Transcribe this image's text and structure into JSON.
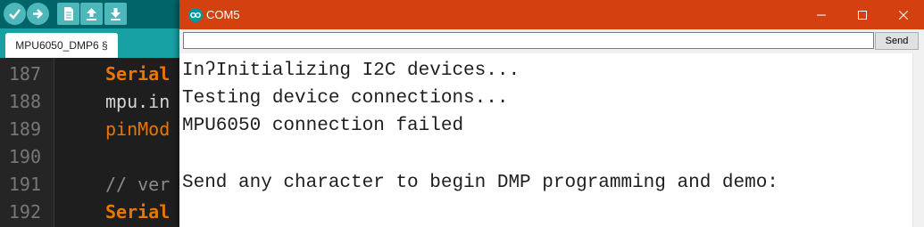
{
  "ide": {
    "toolbar": {
      "buttons": [
        {
          "icon": "verify-icon"
        },
        {
          "icon": "upload-icon"
        },
        {
          "icon": "new-sketch-icon"
        },
        {
          "icon": "open-icon"
        },
        {
          "icon": "save-icon"
        }
      ],
      "colors": {
        "background": "#006468",
        "button": "#4db7bb"
      }
    },
    "tab": {
      "label": "MPU6050_DMP6 §"
    },
    "editor": {
      "line_numbers": [
        "187",
        "188",
        "189",
        "190",
        "191",
        "192"
      ],
      "lines": [
        {
          "text": "Serial",
          "style": "keyword"
        },
        {
          "text": "mpu.in",
          "style": "plain"
        },
        {
          "text": "pinMod",
          "style": "function"
        },
        {
          "text": "",
          "style": "plain"
        },
        {
          "text": "// ver",
          "style": "comment"
        },
        {
          "text": "Serial",
          "style": "keyword"
        }
      ]
    }
  },
  "serial_monitor": {
    "title": "COM5",
    "title_bar_color": "#d4400f",
    "input": {
      "value": "",
      "placeholder": ""
    },
    "send_label": "Send",
    "output_lines": [
      "InʔInitializing I2C devices...",
      "Testing device connections...",
      "MPU6050 connection failed",
      "",
      "Send any character to begin DMP programming and demo:"
    ],
    "window_controls": [
      "minimize-icon",
      "maximize-icon",
      "close-icon"
    ]
  }
}
